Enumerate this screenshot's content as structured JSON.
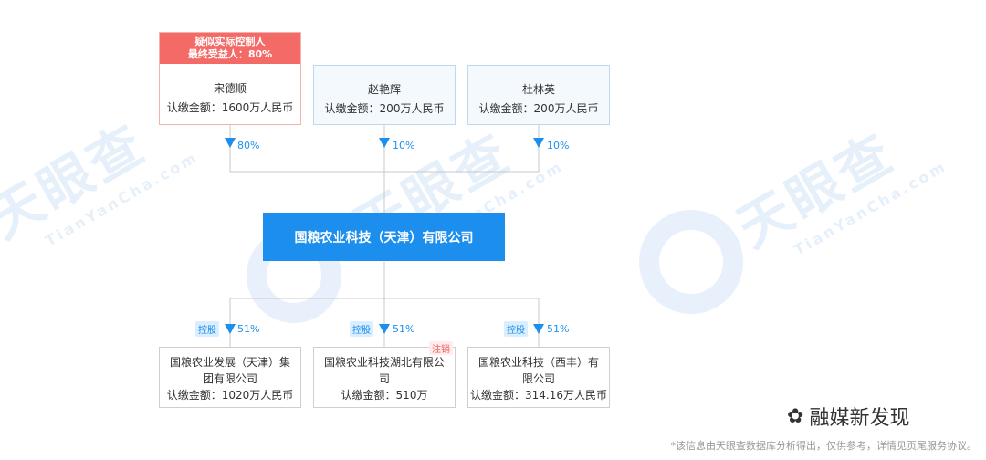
{
  "controller": {
    "tag_line1": "疑似实际控制人",
    "tag_line2": "最终受益人：80%",
    "name": "宋德顺",
    "amount": "认缴金额：1600万人民币",
    "percent": "80%"
  },
  "shareholders": [
    {
      "name": "赵艳辉",
      "amount": "认缴金额：200万人民币",
      "percent": "10%"
    },
    {
      "name": "杜林英",
      "amount": "认缴金额：200万人民币",
      "percent": "10%"
    }
  ],
  "center_company": "国粮农业科技（天津）有限公司",
  "subsidiaries": [
    {
      "tag": "控股",
      "percent": "51%",
      "name_line1": "国粮农业发展（天津）集",
      "name_line2": "团有限公司",
      "amount": "认缴金额：1020万人民币",
      "status": ""
    },
    {
      "tag": "控股",
      "percent": "51%",
      "name_line1": "国粮农业科技湖北有限公",
      "name_line2": "司",
      "amount": "认缴金额：510万",
      "status": "注销"
    },
    {
      "tag": "控股",
      "percent": "51%",
      "name_line1": "国粮农业科技（西丰）有",
      "name_line2": "限公司",
      "amount": "认缴金额：314.16万人民币",
      "status": ""
    }
  ],
  "watermark": {
    "text_cn": "天眼查",
    "text_en": "TianYanCha.com"
  },
  "brand": "融媒新发现",
  "footer_note": "*该信息由天眼查数据库分析得出，仅供参考，详情见页尾服务协议。",
  "colors": {
    "primary": "#1c8fee",
    "controller_tag": "#f46a66",
    "cancel_tag": "#f25f5c"
  }
}
